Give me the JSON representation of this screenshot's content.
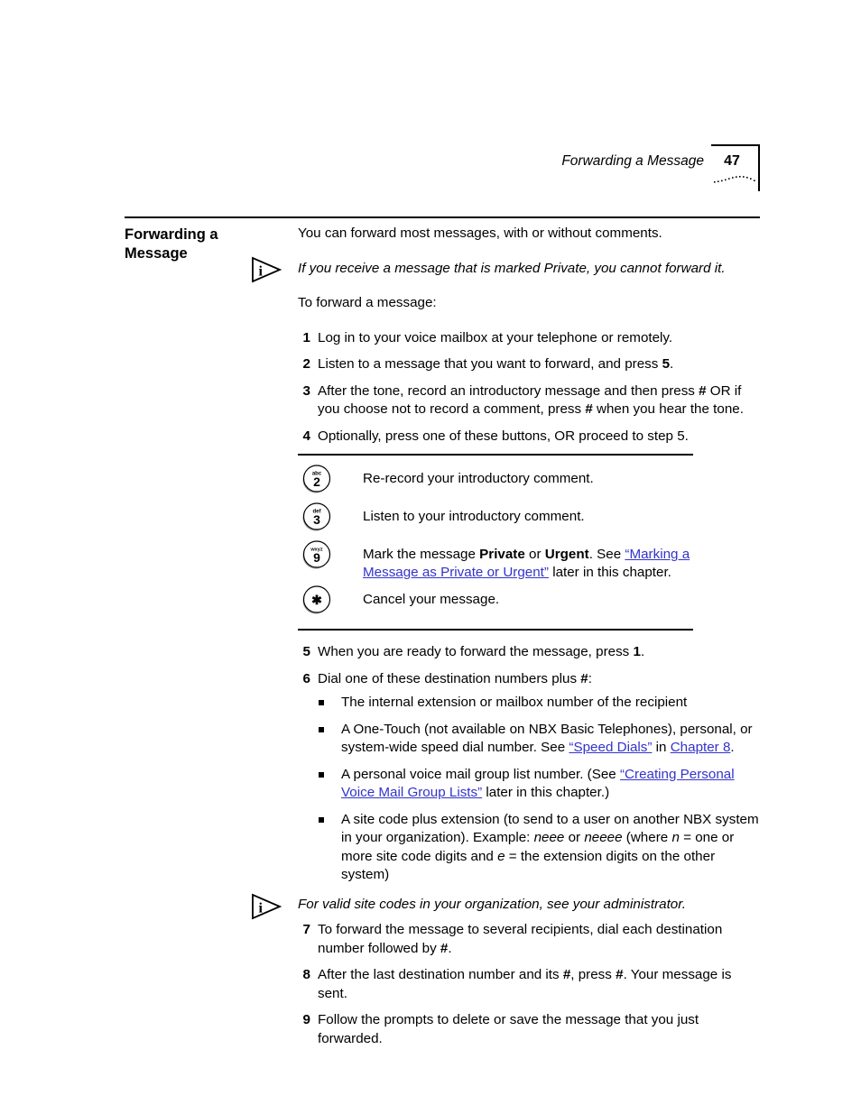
{
  "header": {
    "title": "Forwarding a Message",
    "page_number": "47",
    "dot_wave_icon": "dotted-wave-ornament"
  },
  "section": {
    "title_line1": "Forwarding a",
    "title_line2": "Message"
  },
  "intro": {
    "paragraph": "You can forward most messages, with or without comments.",
    "note": "If you receive a message that is marked Private, you cannot forward it.",
    "lead_in": "To forward a message:"
  },
  "steps": [
    {
      "num": "1",
      "text": "Log in to your voice mailbox at your telephone or remotely."
    },
    {
      "num": "2",
      "text_a": "Listen to a message that you want to forward, and press ",
      "bold": "5",
      "text_b": "."
    },
    {
      "num": "3",
      "text_a": "After the tone, record an introductory message and then press ",
      "bold_a": "#",
      "text_b": " OR if you choose not to record a comment, press ",
      "bold_b": "#",
      "text_c": " when you hear the tone."
    },
    {
      "num": "4",
      "text": "Optionally, press one of these buttons, OR proceed to step 5."
    },
    {
      "num": "5",
      "text_a": "When you are ready to forward the message, press ",
      "bold": "1",
      "text_b": "."
    },
    {
      "num": "6",
      "text_a": "Dial one of these destination numbers plus ",
      "bold": "#",
      "text_b": ":"
    },
    {
      "num": "7",
      "text_a": "To forward the message to several recipients, dial each destination number followed by ",
      "bold": "#",
      "text_b": "."
    },
    {
      "num": "8",
      "text_a": "After the last destination number and its ",
      "bold_a": "#",
      "text_b": ", press ",
      "bold_b": "#",
      "text_c": ". Your message is sent."
    },
    {
      "num": "9",
      "text": "Follow the prompts to delete or save the message that you just forwarded."
    }
  ],
  "key_table": {
    "rows": [
      {
        "key_icon": "phone-key-2",
        "key_letters": "abc",
        "key_digit": "2",
        "description": "Re-record your introductory comment."
      },
      {
        "key_icon": "phone-key-3",
        "key_letters": "def",
        "key_digit": "3",
        "description": "Listen to your introductory comment."
      },
      {
        "key_icon": "phone-key-9",
        "key_letters": "wxyz",
        "key_digit": "9",
        "description_a": "Mark the message ",
        "description_bold_a": "Private",
        "description_b": " or ",
        "description_bold_b": "Urgent",
        "description_c": ". See ",
        "link": "“Marking a Message as Private or Urgent”",
        "description_d": " later in this chapter."
      },
      {
        "key_icon": "phone-key-star",
        "key_letters": "",
        "key_digit": "✱",
        "description": "Cancel your message."
      }
    ]
  },
  "bullets": [
    {
      "text": "The internal extension or mailbox number of the recipient"
    },
    {
      "text_a": "A One-Touch (not available on NBX Basic Telephones), personal, or system-wide speed dial number. See ",
      "link_a": "“Speed Dials”",
      "text_b": " in ",
      "link_b": "Chapter 8",
      "text_c": "."
    },
    {
      "text_a": "A personal voice mail group list number. (See ",
      "link": "“Creating Personal Voice Mail Group Lists”",
      "text_b": " later in this chapter.)"
    },
    {
      "text_a": "A site code plus extension (to send to a user on another NBX system in your organization). Example: ",
      "italic_a": "neee",
      "text_b": " or ",
      "italic_b": "neeee",
      "text_c": " (where ",
      "italic_c": "n",
      "text_d": " = one or more site code digits and ",
      "italic_d": "e",
      "text_e": " = the extension digits on the other system)"
    }
  ],
  "site_code_note": {
    "text": "For valid site codes in your organization, see your administrator."
  },
  "colors": {
    "link": "#3333cc",
    "text": "#000000",
    "rule": "#000000"
  },
  "icons": {
    "info": "info-triangle-icon"
  }
}
